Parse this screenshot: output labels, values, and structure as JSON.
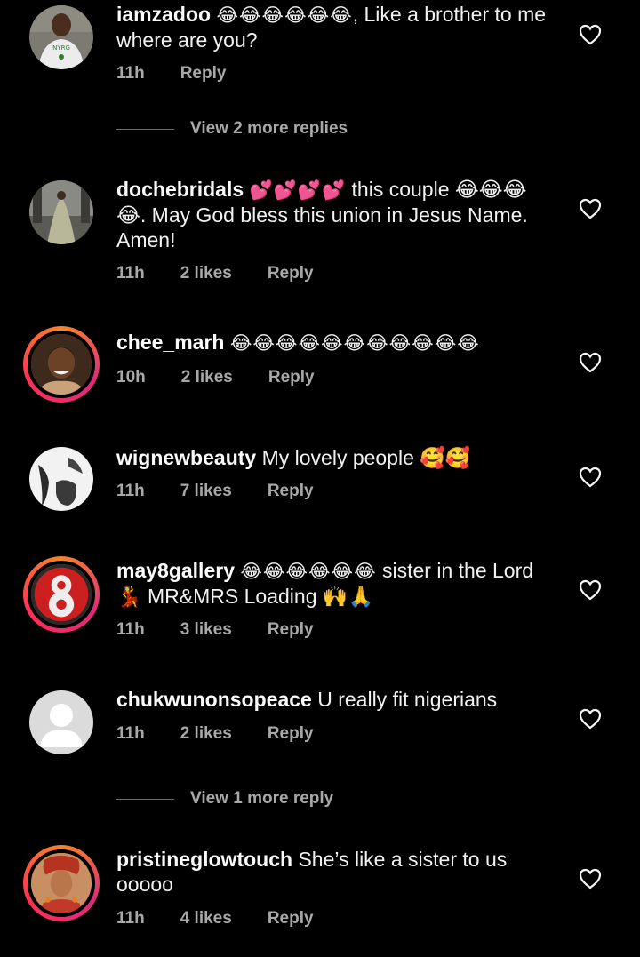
{
  "comments": [
    {
      "username": "iamzadoo",
      "emoji": "😂😂😂😂😂😂",
      "text": ", Like a brother to me where are you?",
      "time": "11h",
      "likes": "",
      "reply": "Reply",
      "story_ring": false
    },
    {
      "username": "dochebridals",
      "emoji": "💕💕💕💕",
      "text": " this couple 😂😂😂😂. May God bless this union in Jesus Name. Amen!",
      "time": "11h",
      "likes": "2 likes",
      "reply": "Reply",
      "story_ring": false
    },
    {
      "username": "chee_marh",
      "emoji": "😂😂😂😂😂😂😂😂😂😂😂",
      "text": "",
      "time": "10h",
      "likes": "2 likes",
      "reply": "Reply",
      "story_ring": true
    },
    {
      "username": "wignewbeauty",
      "emoji": "",
      "text": " My lovely people 🥰🥰",
      "time": "11h",
      "likes": "7 likes",
      "reply": "Reply",
      "story_ring": false
    },
    {
      "username": "may8gallery",
      "emoji": "😂😂😂😂😂😂",
      "text": " sister in the Lord 💃 MR&MRS Loading 🙌🙏",
      "time": "11h",
      "likes": "3 likes",
      "reply": "Reply",
      "story_ring": true
    },
    {
      "username": "chukwunonsopeace",
      "emoji": "",
      "text": " U really fit nigerians",
      "time": "11h",
      "likes": "2 likes",
      "reply": "Reply",
      "story_ring": false
    },
    {
      "username": "pristineglowtouch",
      "emoji": "",
      "text": " She’s like a sister to us ooooo",
      "time": "11h",
      "likes": "4 likes",
      "reply": "Reply",
      "story_ring": true
    }
  ],
  "view_more": [
    {
      "label": "View 2 more replies"
    },
    {
      "label": "View 1 more reply"
    }
  ],
  "avatar_text": {
    "iamzadoo": "NYRG"
  },
  "icons": {
    "like": "heart-outline-icon"
  },
  "colors": {
    "background": "#000000",
    "text": "#f1f1f1",
    "meta": "#a8a8a8",
    "story_ring_start": "#f58529",
    "story_ring_end": "#dd2a7b"
  }
}
